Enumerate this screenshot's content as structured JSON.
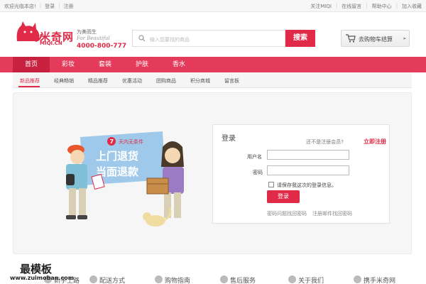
{
  "topbar": {
    "welcome": "欢迎光临本店!",
    "login": "登录",
    "register": "注册",
    "follow": "关注MIQI",
    "message": "在线留言",
    "help": "帮助中心",
    "favorite": "加入收藏"
  },
  "header": {
    "logo_text": "米奇网",
    "logo_sub": "MIQI.CN",
    "slogan": "为美而生",
    "slogan_en": "For Beautiful",
    "phone": "4000-800-777",
    "search_placeholder": "输入您要找的商品",
    "search_button": "搜索",
    "cart_label": "去购物车结算"
  },
  "mainnav": [
    "首页",
    "彩妆",
    "套装",
    "护肤",
    "香水"
  ],
  "subnav": [
    "新品推荐",
    "经典畅销",
    "精品推荐",
    "优惠活动",
    "团购商品",
    "积分商城",
    "留言板"
  ],
  "illustration": {
    "banner_num": "7",
    "banner_top": "天内无条件",
    "banner_line1": "上门退货",
    "banner_line2": "当面退款"
  },
  "login": {
    "title": "登录",
    "hint": "还不是注册会员?",
    "register_link": "立即注册",
    "username_label": "用户名",
    "password_label": "密码",
    "remember_label": "请保存我这次的登录信息。",
    "submit": "登录",
    "forgot": "密码问题找回密码",
    "email_find": "注册邮件找回密码"
  },
  "watermark": {
    "line1": "最模板",
    "line2": "www.zuimoban.com"
  },
  "footer": [
    "新手上路",
    "配送方式",
    "购物指南",
    "售后服务",
    "关于我们",
    "携手米奇网"
  ],
  "colors": {
    "brand": "#e02a48",
    "nav_bg": "#e43b5b",
    "nav_active": "#c8213f"
  }
}
